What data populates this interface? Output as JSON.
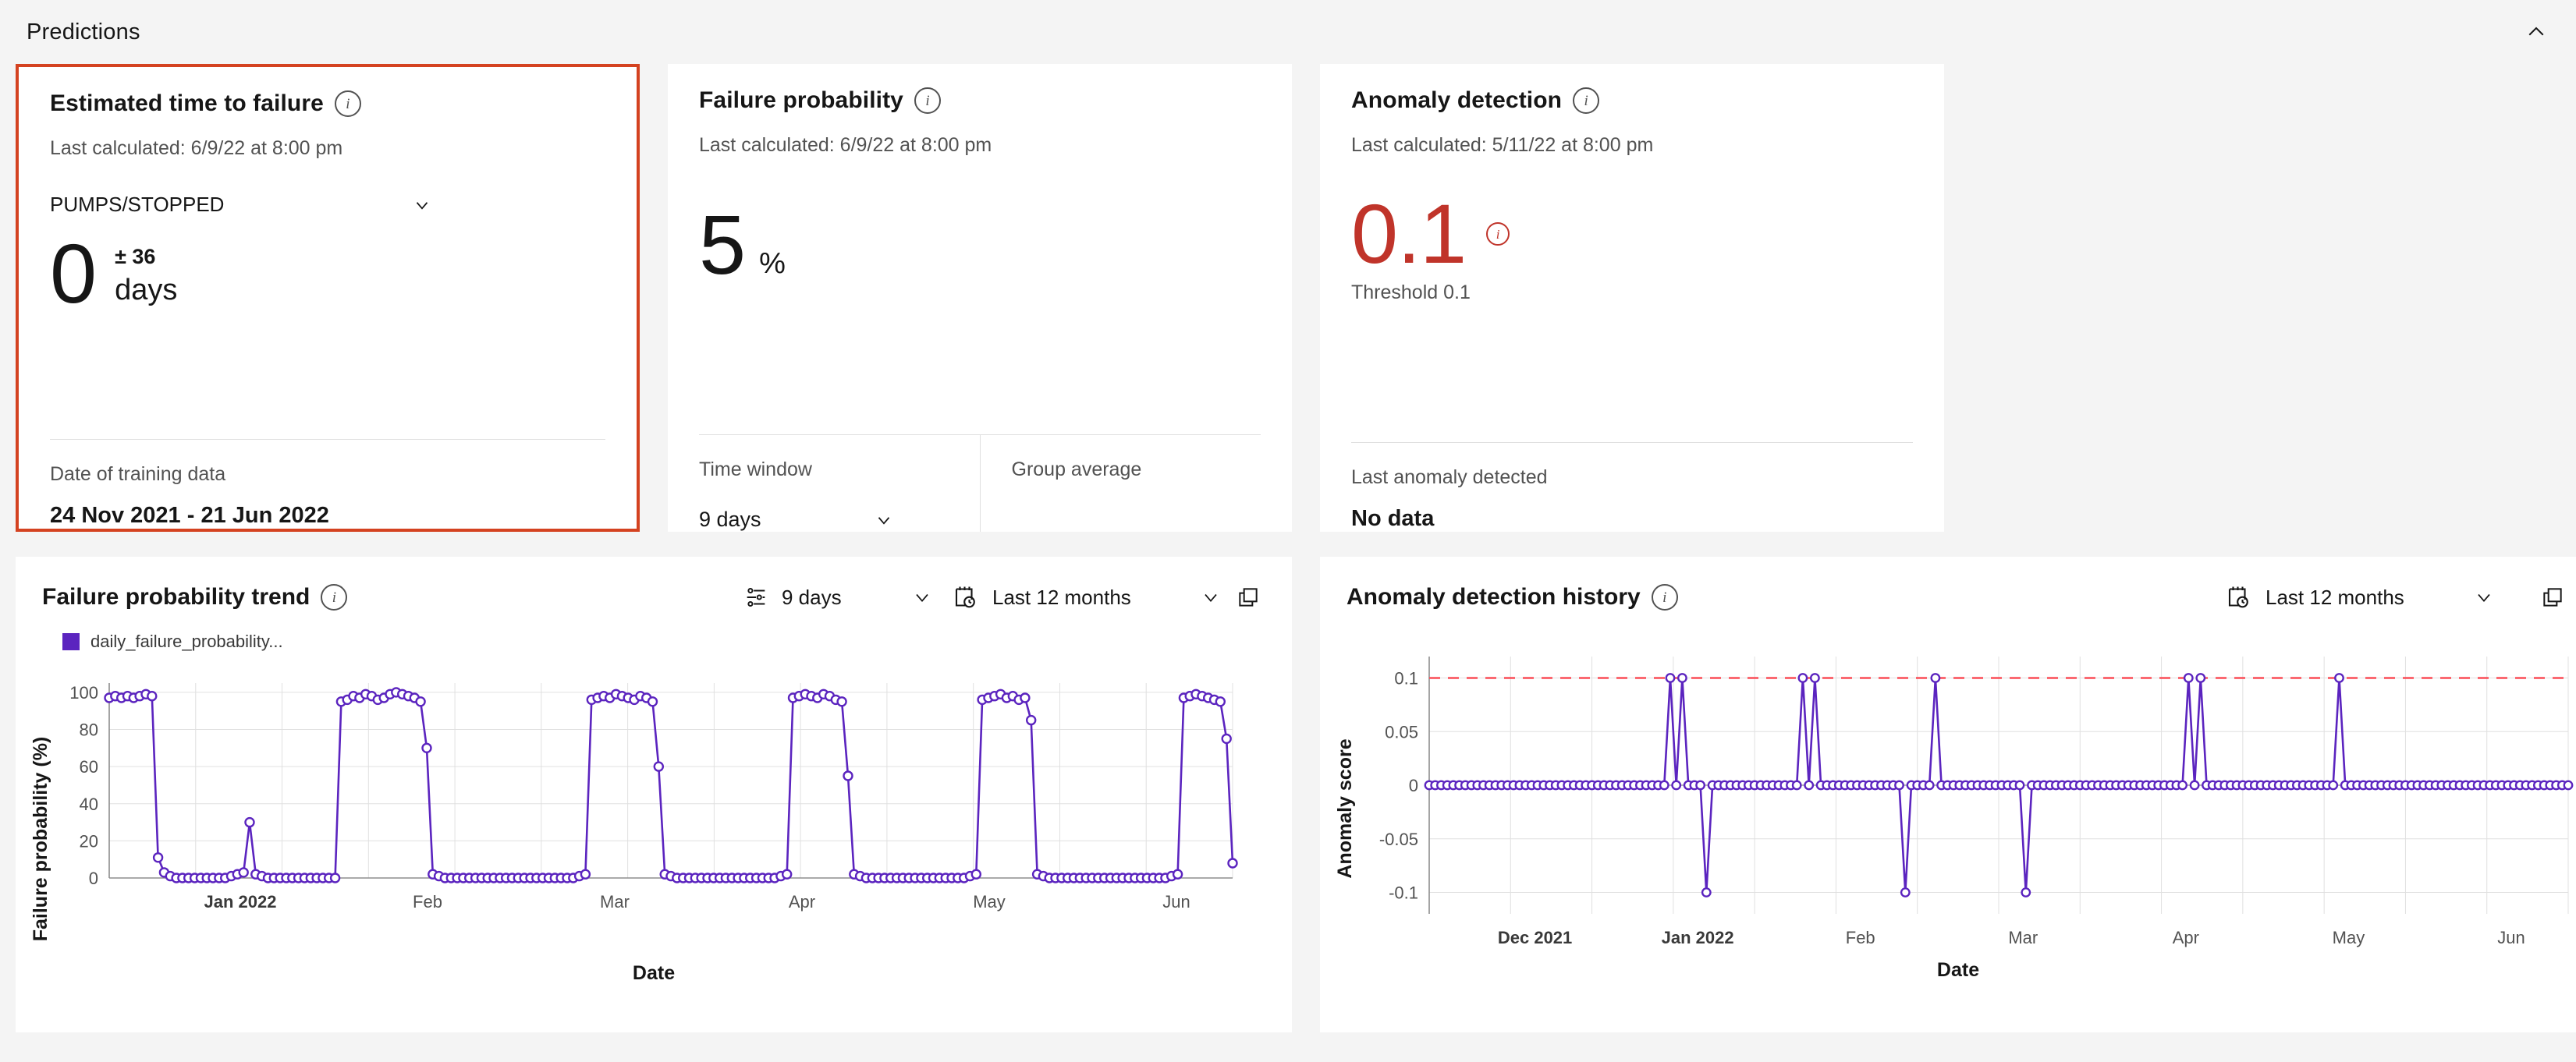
{
  "section": {
    "title": "Predictions",
    "collapse_icon": "chevron-up-icon"
  },
  "cards": {
    "estimated_time_to_failure": {
      "title": "Estimated time to failure",
      "info_icon": "info-icon",
      "last_calculated": "Last calculated: 6/9/22 at 8:00 pm",
      "asset_select_value": "PUMPS/STOPPED",
      "value": "0",
      "margin": "± 36",
      "unit": "days",
      "footer_label": "Date of training data",
      "footer_value": "24 Nov 2021 - 21 Jun 2022",
      "highlight_color": "#d44220"
    },
    "failure_probability": {
      "title": "Failure probability",
      "info_icon": "info-icon",
      "last_calculated": "Last calculated: 6/9/22 at 8:00 pm",
      "value": "5",
      "unit": "%",
      "time_window_label": "Time window",
      "time_window_value": "9 days",
      "group_average_label": "Group average",
      "group_average_value": ""
    },
    "anomaly_detection": {
      "title": "Anomaly detection",
      "info_icon": "info-icon",
      "last_calculated": "Last calculated: 5/11/22 at 8:00 pm",
      "value": "0.1",
      "value_color": "#c0342a",
      "threshold": "Threshold 0.1",
      "footer_label": "Last anomaly detected",
      "footer_value": "No data"
    }
  },
  "charts": {
    "failure_probability_trend": {
      "title": "Failure probability trend",
      "info_icon": "info-icon",
      "settings_icon": "sliders-icon",
      "window_value": "9 days",
      "calendar_icon": "calendar-clock-icon",
      "range_value": "Last 12 months",
      "expand_icon": "copy-icon",
      "legend_label": "daily_failure_probability..."
    },
    "anomaly_detection_history": {
      "title": "Anomaly detection history",
      "info_icon": "info-icon",
      "calendar_icon": "calendar-clock-icon",
      "range_value": "Last 12 months",
      "expand_icon": "copy-icon"
    }
  },
  "chart_data": [
    {
      "type": "line",
      "name": "failure_probability_trend",
      "title": "Failure probability trend",
      "xlabel": "Date",
      "ylabel": "Failure probability (%)",
      "ylim": [
        0,
        105
      ],
      "yticks": [
        0,
        20,
        40,
        60,
        80,
        100
      ],
      "xticks": [
        "Jan 2022",
        "Feb",
        "Mar",
        "Apr",
        "May",
        "Jun"
      ],
      "grid": true,
      "legend_position": "top-left",
      "series": [
        {
          "name": "daily_failure_probability...",
          "color": "#5b24bf",
          "marker": "circle-open",
          "x": [
            0,
            1,
            2,
            3,
            4,
            5,
            6,
            7,
            8,
            9,
            10,
            11,
            12,
            13,
            14,
            15,
            16,
            17,
            18,
            19,
            20,
            21,
            22,
            23,
            24,
            25,
            26,
            27,
            28,
            29,
            30,
            31,
            32,
            33,
            34,
            35,
            36,
            37,
            38,
            39,
            40,
            41,
            42,
            43,
            44,
            45,
            46,
            47,
            48,
            49,
            50,
            51,
            52,
            53,
            54,
            55,
            56,
            57,
            58,
            59,
            60,
            61,
            62,
            63,
            64,
            65,
            66,
            67,
            68,
            69,
            70,
            71,
            72,
            73,
            74,
            75,
            76,
            77,
            78,
            79,
            80,
            81,
            82,
            83,
            84,
            85,
            86,
            87,
            88,
            89,
            90,
            91,
            92,
            93,
            94,
            95,
            96,
            97,
            98,
            99,
            100,
            101,
            102,
            103,
            104,
            105,
            106,
            107,
            108,
            109,
            110,
            111,
            112,
            113,
            114,
            115,
            116,
            117,
            118,
            119,
            120,
            121,
            122,
            123,
            124,
            125,
            126,
            127,
            128,
            129,
            130,
            131,
            132,
            133,
            134,
            135,
            136,
            137,
            138,
            139,
            140,
            141,
            142,
            143,
            144,
            145,
            146,
            147,
            148,
            149,
            150,
            151,
            152,
            153,
            154,
            155,
            156,
            157,
            158,
            159,
            160,
            161,
            162,
            163,
            164,
            165,
            166,
            167,
            168,
            169,
            170,
            171,
            172,
            173,
            174,
            175,
            176,
            177,
            178,
            179
          ],
          "values": [
            97,
            98,
            97,
            98,
            97,
            98,
            99,
            98,
            11,
            3,
            1,
            0,
            0,
            0,
            0,
            0,
            0,
            0,
            0,
            0,
            1,
            2,
            3,
            30,
            2,
            1,
            0,
            0,
            0,
            0,
            0,
            0,
            0,
            0,
            0,
            0,
            0,
            0,
            95,
            96,
            98,
            97,
            99,
            98,
            96,
            97,
            99,
            100,
            99,
            98,
            97,
            95,
            70,
            2,
            1,
            0,
            0,
            0,
            0,
            0,
            0,
            0,
            0,
            0,
            0,
            0,
            0,
            0,
            0,
            0,
            0,
            0,
            0,
            0,
            0,
            0,
            0,
            1,
            2,
            96,
            97,
            98,
            97,
            99,
            98,
            97,
            96,
            98,
            97,
            95,
            60,
            2,
            1,
            0,
            0,
            0,
            0,
            0,
            0,
            0,
            0,
            0,
            0,
            0,
            0,
            0,
            0,
            0,
            0,
            0,
            1,
            2,
            97,
            98,
            99,
            98,
            97,
            99,
            98,
            96,
            95,
            55,
            2,
            1,
            0,
            0,
            0,
            0,
            0,
            0,
            0,
            0,
            0,
            0,
            0,
            0,
            0,
            0,
            0,
            0,
            0,
            1,
            2,
            96,
            97,
            98,
            99,
            97,
            98,
            96,
            97,
            85,
            2,
            1,
            0,
            0,
            0,
            0,
            0,
            0,
            0,
            0,
            0,
            0,
            0,
            0,
            0,
            0,
            0,
            0,
            0,
            0,
            0,
            0,
            1,
            2,
            97,
            98,
            99,
            98,
            97,
            96,
            95,
            75,
            8
          ]
        }
      ]
    },
    {
      "type": "line",
      "name": "anomaly_detection_history",
      "title": "Anomaly detection history",
      "xlabel": "Date",
      "ylabel": "Anomaly score",
      "ylim": [
        -0.12,
        0.12
      ],
      "yticks": [
        0.1,
        0.05,
        0,
        -0.05,
        -0.1
      ],
      "xticks": [
        "Dec 2021",
        "Jan 2022",
        "Feb",
        "Mar",
        "Apr",
        "May",
        "Jun"
      ],
      "grid": true,
      "threshold": {
        "value": 0.1,
        "color": "#fa4d56",
        "style": "dashed"
      },
      "series": [
        {
          "name": "anomaly score",
          "color": "#5b24bf",
          "marker": "circle-open",
          "anomaly_peaks_at_0_1": [
            40,
            42,
            62,
            64,
            84,
            126,
            128,
            151
          ],
          "negative_dips_at_minus_0_1": [
            46,
            79,
            99
          ],
          "baseline": 0,
          "n_points": 190
        }
      ]
    }
  ]
}
